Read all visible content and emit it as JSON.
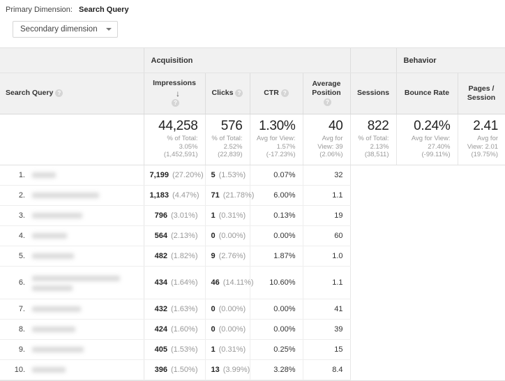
{
  "topbar": {
    "primary_dimension_label": "Primary Dimension:",
    "primary_dimension_value": "Search Query"
  },
  "controls": {
    "secondary_dimension_label": "Secondary dimension",
    "caret_icon": "chevron-down-icon"
  },
  "table": {
    "groups": {
      "dimension": "",
      "acquisition": "Acquisition",
      "behavior": "Behavior"
    },
    "dimension_header": {
      "label": "Search Query",
      "help_icon": "question-mark-icon"
    },
    "columns": [
      {
        "key": "impressions",
        "label": "Impressions",
        "help": true,
        "sorted": true,
        "sort_icon": "arrow-down-icon"
      },
      {
        "key": "clicks",
        "label": "Clicks",
        "help": true,
        "sorted": false
      },
      {
        "key": "ctr",
        "label": "CTR",
        "help": true,
        "sorted": false
      },
      {
        "key": "avg_position",
        "label": "Average Position",
        "help": true,
        "sorted": false
      },
      {
        "key": "sessions",
        "label": "Sessions",
        "help": false,
        "sorted": false
      },
      {
        "key": "bounce_rate",
        "label": "Bounce Rate",
        "help": false,
        "sorted": false
      },
      {
        "key": "pages_session",
        "label": "Pages / Session",
        "help": false,
        "sorted": false
      }
    ],
    "totals": {
      "impressions": {
        "value": "44,258",
        "sub": "% of Total: 3.05% (1,452,591)"
      },
      "clicks": {
        "value": "576",
        "sub": "% of Total: 2.52% (22,839)"
      },
      "ctr": {
        "value": "1.30%",
        "sub": "Avg for View: 1.57% (-17.23%)"
      },
      "avg_position": {
        "value": "40",
        "sub": "Avg for View: 39 (2.06%)"
      },
      "sessions": {
        "value": "822",
        "sub": "% of Total: 2.13% (38,511)"
      },
      "bounce_rate": {
        "value": "0.24%",
        "sub": "Avg for View: 27.40% (-99.11%)"
      },
      "pages_session": {
        "value": "2.41",
        "sub": "Avg for View: 2.01 (19.75%)"
      }
    },
    "rows": [
      {
        "num": "1.",
        "query": "",
        "redacted": true,
        "redact_widths": [
          34
        ],
        "impressions": "7,199",
        "impressions_pct": "(27.20%)",
        "clicks": "5",
        "clicks_pct": "(1.53%)",
        "ctr": "0.07%",
        "avg_position": "32",
        "sessions": "",
        "bounce_rate": "",
        "pages_session": ""
      },
      {
        "num": "2.",
        "query": "",
        "redacted": true,
        "redact_widths": [
          96
        ],
        "impressions": "1,183",
        "impressions_pct": "(4.47%)",
        "clicks": "71",
        "clicks_pct": "(21.78%)",
        "ctr": "6.00%",
        "avg_position": "1.1",
        "sessions": "",
        "bounce_rate": "",
        "pages_session": ""
      },
      {
        "num": "3.",
        "query": "",
        "redacted": true,
        "redact_widths": [
          72
        ],
        "impressions": "796",
        "impressions_pct": "(3.01%)",
        "clicks": "1",
        "clicks_pct": "(0.31%)",
        "ctr": "0.13%",
        "avg_position": "19",
        "sessions": "",
        "bounce_rate": "",
        "pages_session": ""
      },
      {
        "num": "4.",
        "query": "",
        "redacted": true,
        "redact_widths": [
          50
        ],
        "impressions": "564",
        "impressions_pct": "(2.13%)",
        "clicks": "0",
        "clicks_pct": "(0.00%)",
        "ctr": "0.00%",
        "avg_position": "60",
        "sessions": "",
        "bounce_rate": "",
        "pages_session": ""
      },
      {
        "num": "5.",
        "query": "",
        "redacted": true,
        "redact_widths": [
          60
        ],
        "impressions": "482",
        "impressions_pct": "(1.82%)",
        "clicks": "9",
        "clicks_pct": "(2.76%)",
        "ctr": "1.87%",
        "avg_position": "1.0",
        "sessions": "",
        "bounce_rate": "",
        "pages_session": ""
      },
      {
        "num": "6.",
        "query": "",
        "redacted": true,
        "redact_widths": [
          126,
          58
        ],
        "impressions": "434",
        "impressions_pct": "(1.64%)",
        "clicks": "46",
        "clicks_pct": "(14.11%)",
        "ctr": "10.60%",
        "avg_position": "1.1",
        "sessions": "",
        "bounce_rate": "",
        "pages_session": ""
      },
      {
        "num": "7.",
        "query": "",
        "redacted": true,
        "redact_widths": [
          70
        ],
        "impressions": "432",
        "impressions_pct": "(1.63%)",
        "clicks": "0",
        "clicks_pct": "(0.00%)",
        "ctr": "0.00%",
        "avg_position": "41",
        "sessions": "",
        "bounce_rate": "",
        "pages_session": ""
      },
      {
        "num": "8.",
        "query": "",
        "redacted": true,
        "redact_widths": [
          62
        ],
        "impressions": "424",
        "impressions_pct": "(1.60%)",
        "clicks": "0",
        "clicks_pct": "(0.00%)",
        "ctr": "0.00%",
        "avg_position": "39",
        "sessions": "",
        "bounce_rate": "",
        "pages_session": ""
      },
      {
        "num": "9.",
        "query": "",
        "redacted": true,
        "redact_widths": [
          74
        ],
        "impressions": "405",
        "impressions_pct": "(1.53%)",
        "clicks": "1",
        "clicks_pct": "(0.31%)",
        "ctr": "0.25%",
        "avg_position": "15",
        "sessions": "",
        "bounce_rate": "",
        "pages_session": ""
      },
      {
        "num": "10.",
        "query": "",
        "redacted": true,
        "redact_widths": [
          48
        ],
        "impressions": "396",
        "impressions_pct": "(1.50%)",
        "clicks": "13",
        "clicks_pct": "(3.99%)",
        "ctr": "3.28%",
        "avg_position": "8.4",
        "sessions": "",
        "bounce_rate": "",
        "pages_session": ""
      }
    ]
  },
  "colors": {
    "header_bg": "#f1f1f1",
    "border": "#e0e0e0",
    "muted_text": "#999999",
    "primary_text": "#333333"
  }
}
